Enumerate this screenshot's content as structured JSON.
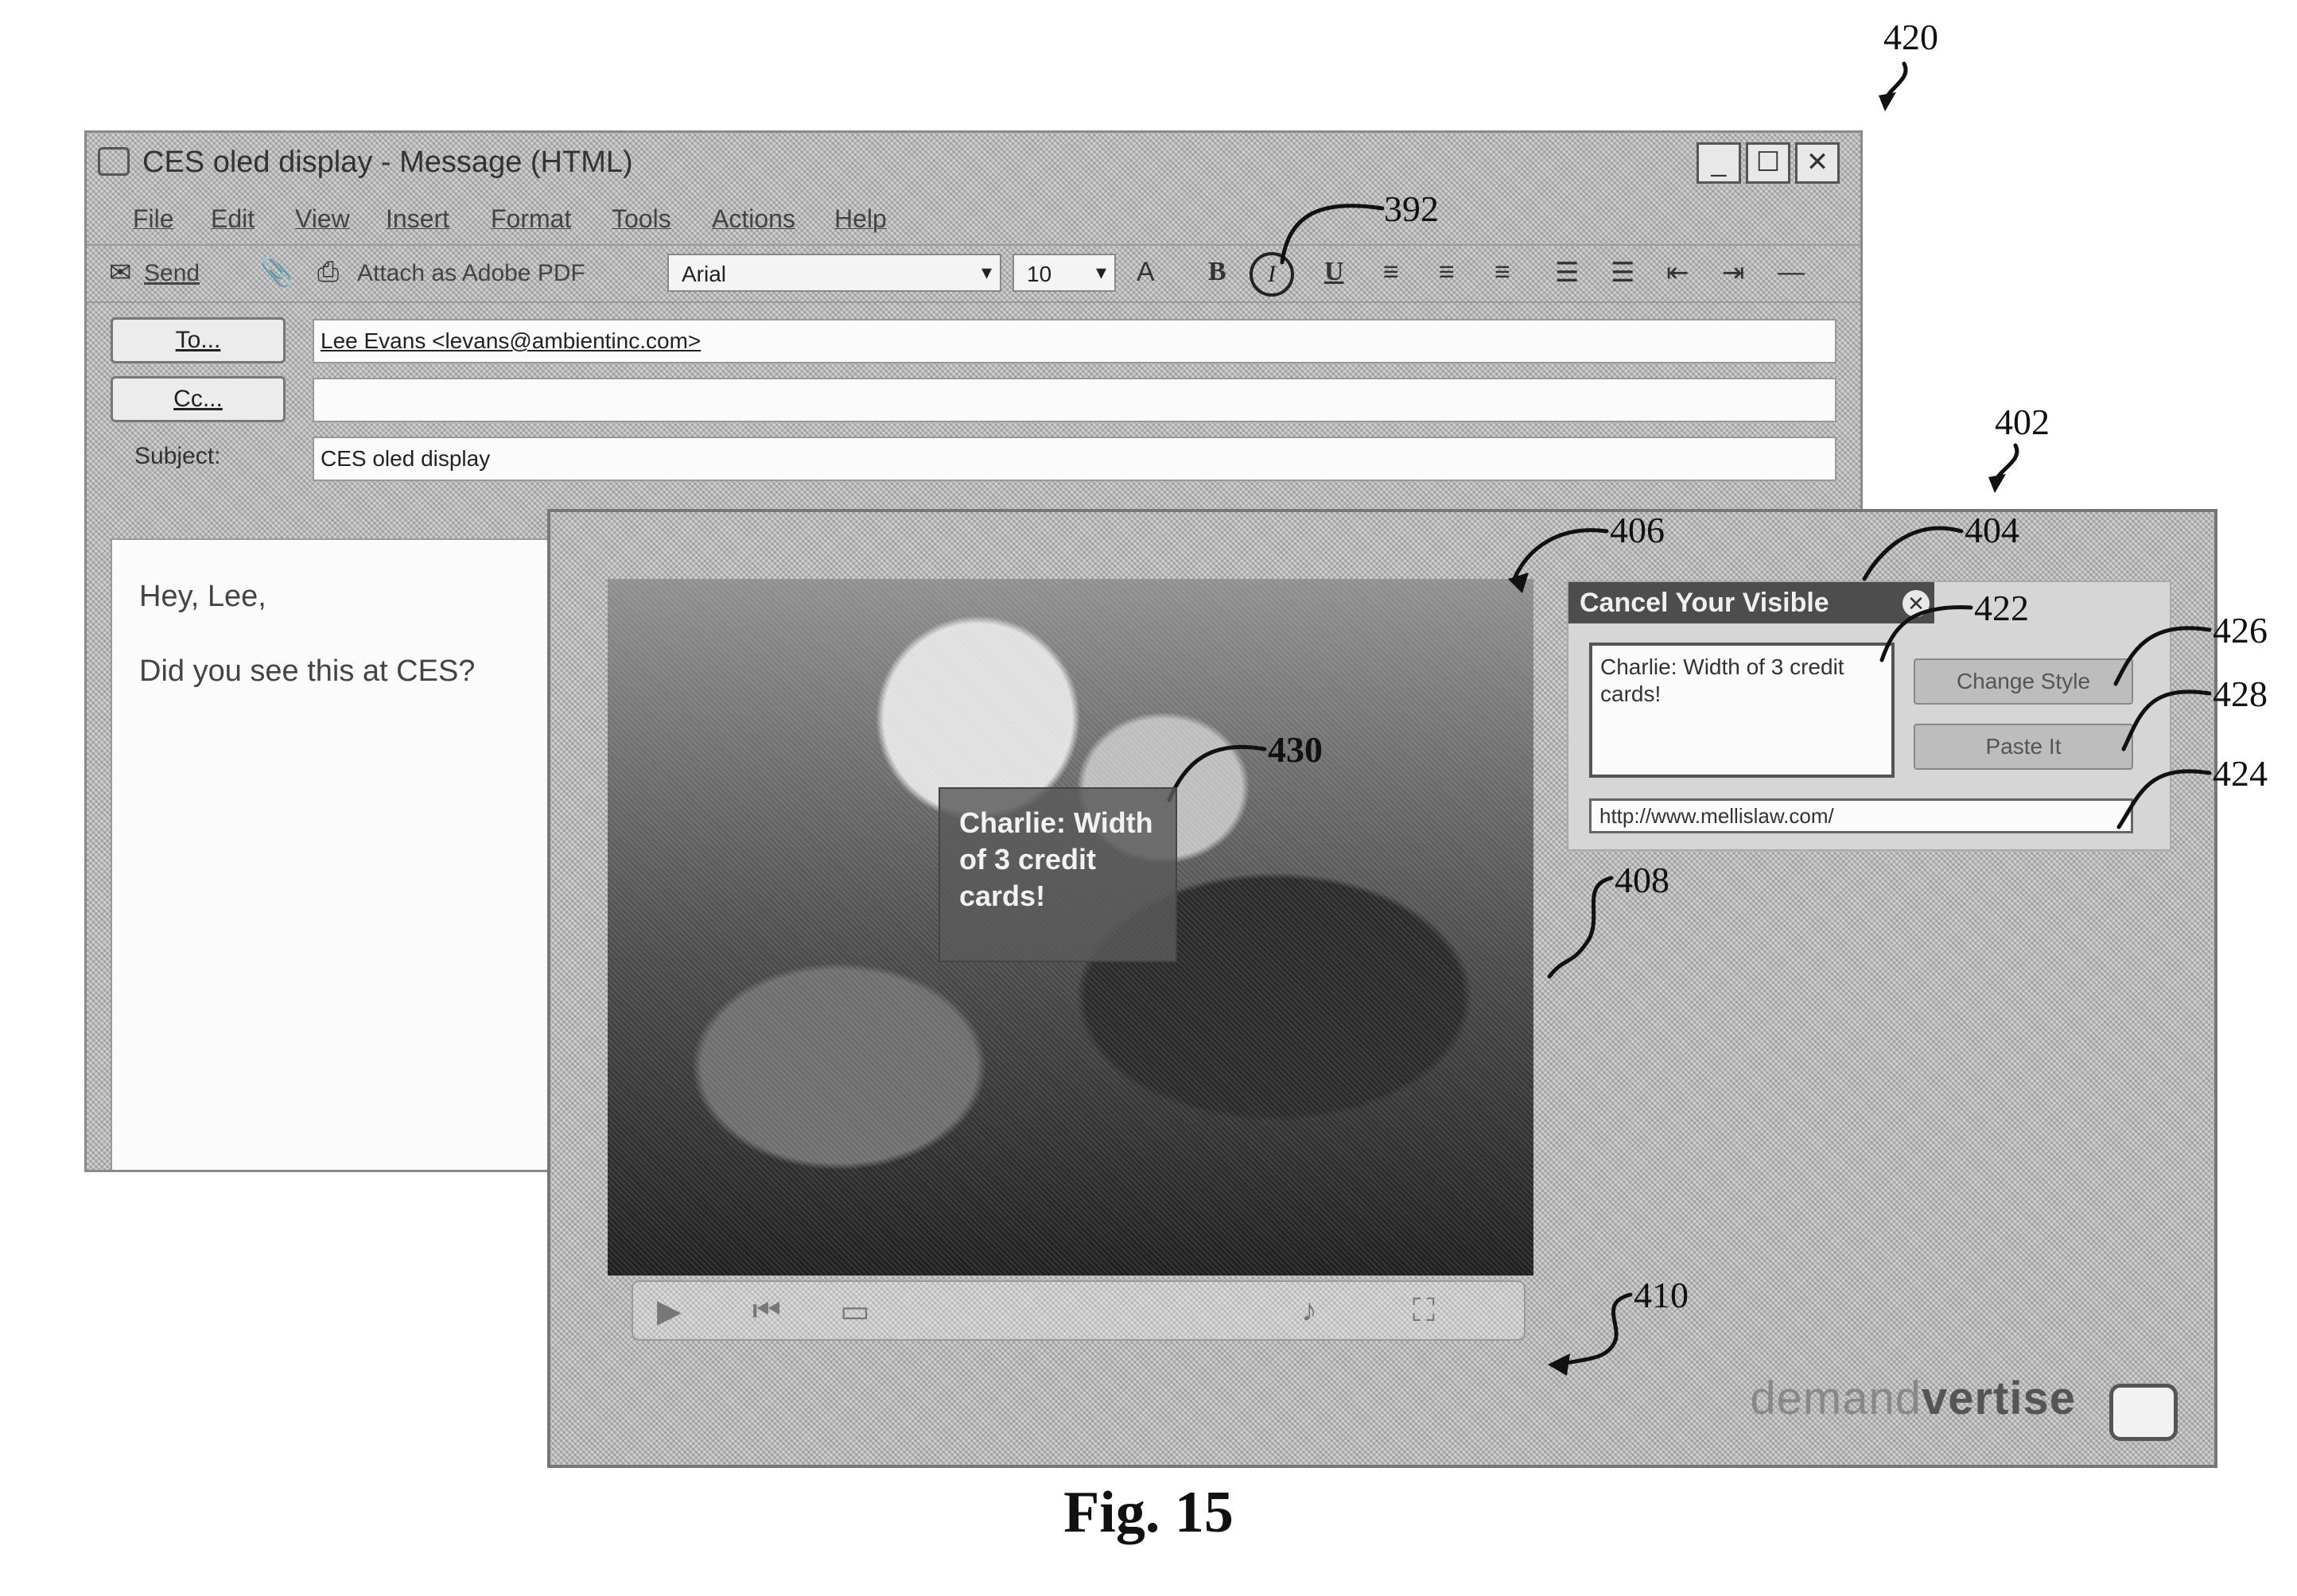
{
  "refs": {
    "r420": "420",
    "r392": "392",
    "r402": "402",
    "r406": "406",
    "r404": "404",
    "r422": "422",
    "r426": "426",
    "r428": "428",
    "r424": "424",
    "r430": "430",
    "r408": "408",
    "r410": "410"
  },
  "message": {
    "title": "CES oled display - Message (HTML)",
    "window_buttons": [
      "_",
      "☐",
      "✕"
    ],
    "menu": [
      "File",
      "Edit",
      "View",
      "Insert",
      "Format",
      "Tools",
      "Actions",
      "Help"
    ],
    "toolbar": {
      "send": "Send",
      "attach_pdf": "Attach as Adobe PDF",
      "font": "Arial",
      "font_size": "10",
      "bold": "B",
      "italic": "I",
      "underline": "U"
    },
    "to_button": "To...",
    "cc_button": "Cc...",
    "to_value": "Lee Evans <levans@ambientinc.com>",
    "cc_value": "",
    "subject_label": "Subject:",
    "subject_value": "CES oled display",
    "body_lines": [
      "Hey, Lee,",
      "Did you see this at CES?"
    ]
  },
  "ad": {
    "bubble_text": "Charlie: Width of 3 credit cards!",
    "widget": {
      "title": "Cancel Your Visible",
      "textarea_value": "Charlie: Width of 3 credit cards!",
      "change_button": "Change Style",
      "paste_button": "Paste It",
      "url_value": "http://www.mellislaw.com/"
    },
    "brand_light": "demand",
    "brand_bold": "vertise"
  },
  "caption": "Fig. 15"
}
